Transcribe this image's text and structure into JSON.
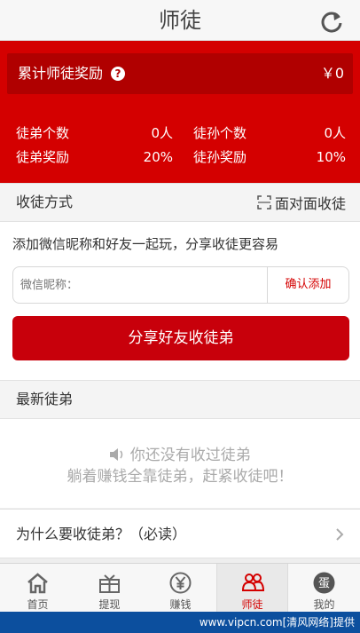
{
  "header": {
    "title": "师徒"
  },
  "bonus": {
    "label": "累计师徒奖励",
    "help": "?",
    "value": "￥0"
  },
  "stats": {
    "disciples_label": "徒弟个数",
    "disciples_value": "0人",
    "grand_label": "徒孙个数",
    "grand_value": "0人",
    "disciple_reward_label": "徒弟奖励",
    "disciple_reward_value": "20%",
    "grand_reward_label": "徒孙奖励",
    "grand_reward_value": "10%"
  },
  "recruit": {
    "title": "收徒方式",
    "face_to_face": "面对面收徒",
    "description": "添加微信昵称和好友一起玩，分享收徒更容易",
    "input_placeholder": "微信昵称：",
    "confirm_label": "确认添加",
    "share_label": "分享好友收徒弟"
  },
  "latest": {
    "title": "最新徒弟",
    "empty_line1": "你还没有收过徒弟",
    "empty_line2": "躺着赚钱全靠徒弟，赶紧收徒吧！"
  },
  "why": {
    "label": "为什么要收徒弟？（必读）"
  },
  "tabs": [
    {
      "label": "首页",
      "icon": "home-icon"
    },
    {
      "label": "提现",
      "icon": "gift-icon"
    },
    {
      "label": "赚钱",
      "icon": "yen-icon"
    },
    {
      "label": "师徒",
      "icon": "people-icon"
    },
    {
      "label": "我的",
      "icon": "egg-icon"
    }
  ],
  "watermark": "www.vipcn.com[清风网络]提供",
  "colors": {
    "primary_red": "#d40000",
    "dark_red": "#b00000",
    "watermark_blue": "#0c4f9e"
  }
}
